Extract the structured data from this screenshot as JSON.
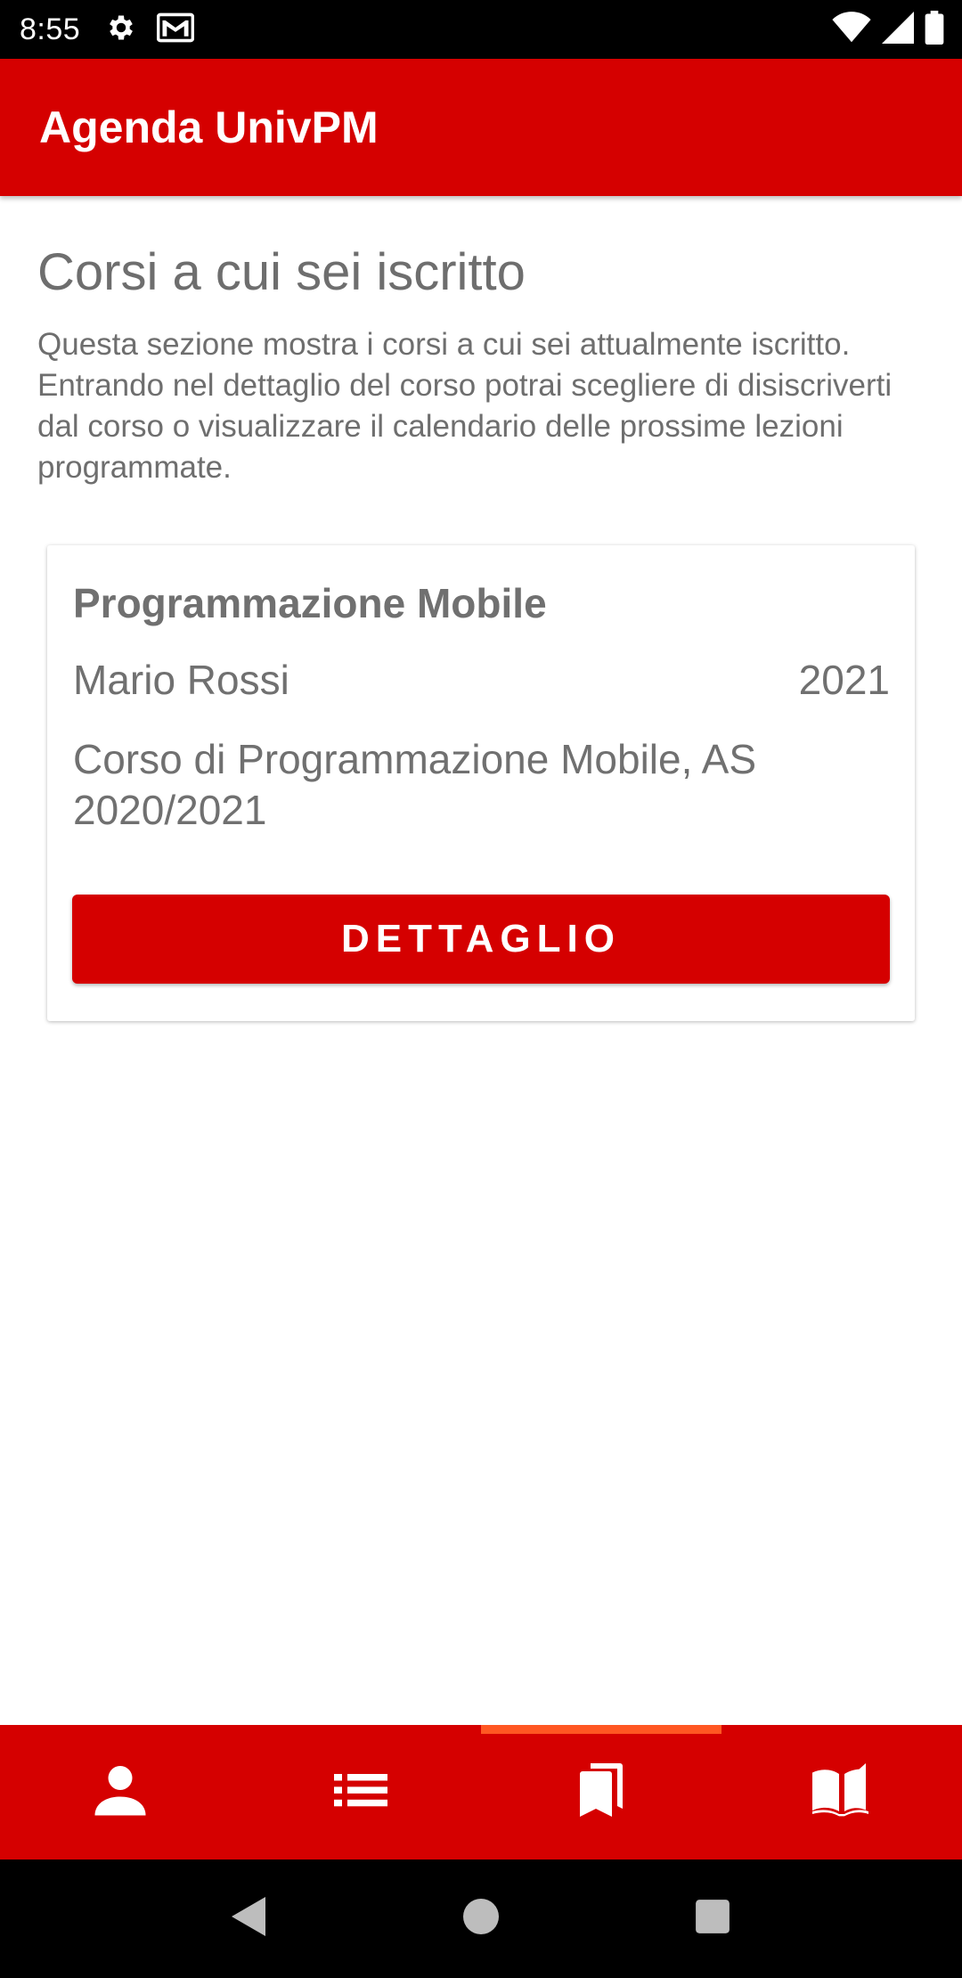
{
  "status_bar": {
    "time": "8:55",
    "icons": [
      "settings-icon",
      "gmail-icon",
      "wifi-icon",
      "signal-icon",
      "battery-icon"
    ]
  },
  "app_bar": {
    "title": "Agenda UnivPM",
    "color": "#d50000"
  },
  "section": {
    "title": "Corsi a cui sei iscritto",
    "description": "Questa sezione mostra i corsi a cui sei attualmente iscritto. Entrando nel dettaglio del corso potrai scegliere di disiscriverti dal corso o visualizzare il calendario delle prossime lezioni programmate."
  },
  "course_card": {
    "title": "Programmazione Mobile",
    "teacher": "Mario Rossi",
    "year": "2021",
    "description": "Corso di Programmazione Mobile, AS 2020/2021",
    "button_label": "DETTAGLIO"
  },
  "bottom_nav": {
    "items": [
      {
        "icon": "person-icon",
        "selected": false
      },
      {
        "icon": "list-icon",
        "selected": false
      },
      {
        "icon": "bookmarks-icon",
        "selected": true
      },
      {
        "icon": "book-open-icon",
        "selected": false
      }
    ],
    "indicator_color": "#ff5722"
  },
  "system_nav": {
    "icons": [
      "back-icon",
      "home-icon",
      "recents-icon"
    ]
  }
}
